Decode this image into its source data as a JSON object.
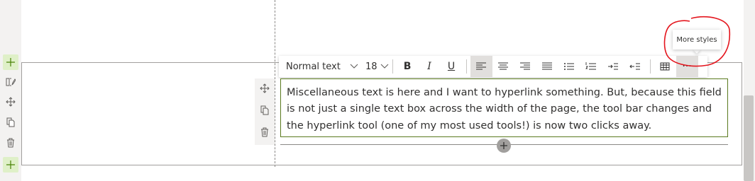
{
  "toolbar": {
    "text_style": "Normal text",
    "font_size": "18",
    "bold_label": "B",
    "italic_label": "I",
    "underline_label": "U",
    "active_alignment": "align-left",
    "more_icon_label": "···"
  },
  "tooltip": {
    "text": "More styles"
  },
  "text_block": {
    "content": "Miscellaneous text is here and I want to hyperlink something. But, because this field is not just a single text box across the width of the page, the tool bar changes and the hyperlink tool (one of my most used tools!) is now two clicks away."
  },
  "colors": {
    "accent_green": "#5a7a1e",
    "add_button_bg": "#dff0c8",
    "annotation_red": "#e4151d"
  },
  "icons": [
    "plus-icon",
    "edit-layout-icon",
    "move-icon",
    "copy-icon",
    "delete-icon",
    "chevron-down-icon",
    "align-left-icon",
    "align-center-icon",
    "align-right-icon",
    "justify-icon",
    "bullet-list-icon",
    "numbered-list-icon",
    "increase-indent-icon",
    "decrease-indent-icon",
    "table-icon",
    "more-icon"
  ]
}
